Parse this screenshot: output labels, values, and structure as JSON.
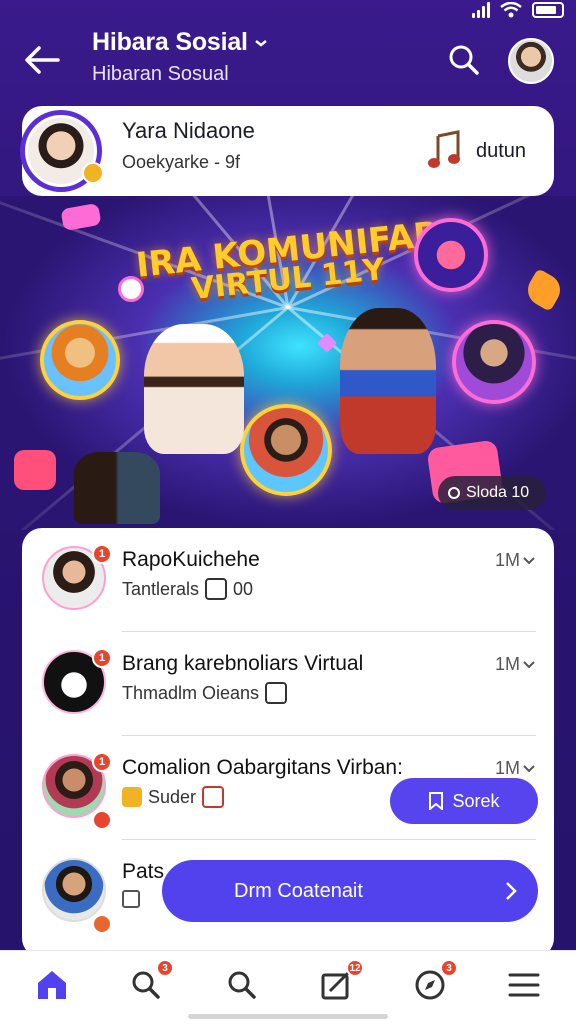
{
  "header": {
    "title": "Hibara Sosial",
    "subtitle": "Hibaran Sosual"
  },
  "profile_card": {
    "name": "Yara Nidaone",
    "meta": "Ooekyarke - 9f",
    "action": "dutun"
  },
  "banner": {
    "title_line1": "IRA KOMUNIFAR",
    "title_line2": "VIRTUL 11Y",
    "pill_label": "Sloda 10"
  },
  "list": {
    "items": [
      {
        "title": "RapoKuichehe",
        "subtitle": "Tantlerals",
        "subtitle_extra": "00",
        "time": "1M",
        "badge": "1"
      },
      {
        "title": "Brang karebnoliars Virtual",
        "subtitle": "Thmadlm Oieans",
        "subtitle_extra": "",
        "time": "1M",
        "badge": "1"
      },
      {
        "title": "Comalion Oabargitans Virban:",
        "subtitle": "Suder",
        "subtitle_extra": "",
        "time": "1M",
        "badge": "1"
      },
      {
        "title": "Pats",
        "subtitle": "",
        "subtitle_extra": "",
        "time": "",
        "badge": ""
      }
    ],
    "join_button": "Sorek",
    "cta_button": "Drm   Coatenait"
  },
  "nav": {
    "badges": {
      "search": "3",
      "compose": "12",
      "explore": "3"
    }
  },
  "colors": {
    "background": "#2a1572",
    "accent": "#5142ee",
    "badge": "#e8452f",
    "banner_title": "#ffcc2a"
  },
  "icons": [
    "back-arrow-icon",
    "chevron-down-icon",
    "search-icon",
    "music-note-icon",
    "home-icon",
    "compose-icon",
    "compass-icon",
    "menu-icon",
    "bookmark-icon",
    "chevron-right-icon"
  ]
}
